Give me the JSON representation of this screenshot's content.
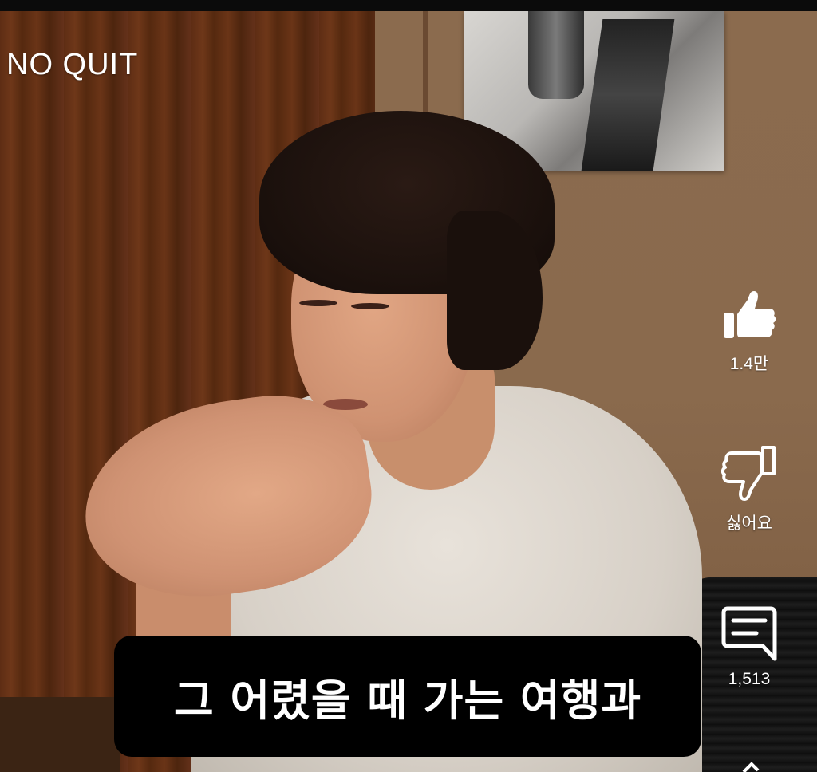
{
  "channel": {
    "name": "NO QUIT"
  },
  "actions": {
    "like": {
      "count": "1.4만",
      "icon": "thumbs-up-icon"
    },
    "dislike": {
      "label": "싫어요",
      "icon": "thumbs-down-icon"
    },
    "comments": {
      "count": "1,513",
      "icon": "comment-icon"
    },
    "share": {
      "icon": "share-icon"
    }
  },
  "subtitle": {
    "text": "그 어렸을 때 가는 여행과"
  },
  "colors": {
    "overlay_text": "#ffffff",
    "subtitle_bg": "#000000",
    "top_bar": "#0b0b0b"
  }
}
